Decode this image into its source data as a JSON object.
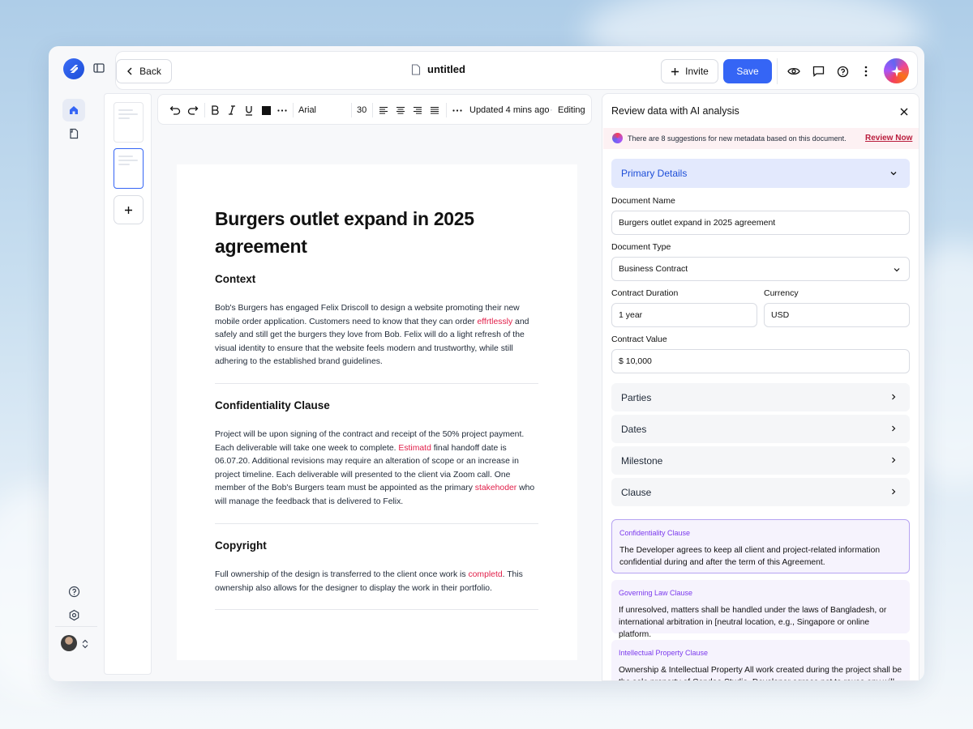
{
  "app": {
    "back_label": "Back",
    "doc_title": "untitled",
    "invite_label": "Invite",
    "save_label": "Save",
    "accent_color": "#3565f5"
  },
  "toolbar": {
    "font_family": "Arial",
    "font_size": "30",
    "updated_text": "Updated 4 mins ago",
    "mode": "Editing"
  },
  "document": {
    "title": "Burgers outlet expand in 2025 agreement",
    "sections": [
      {
        "heading": "Context",
        "parts": [
          "Bob's Burgers has engaged Felix Driscoll to design a website promoting their new mobile order application. Customers need to know that they can order ",
          "effrtlessly",
          " and safely and still get the burgers they love from Bob. Felix will do a light refresh of the visual identity to ensure that the website feels modern and trustworthy, while still adhering to the established brand guidelines."
        ]
      },
      {
        "heading": "Confidentiality Clause",
        "parts": [
          "Project will be upon signing of the contract and receipt of the 50% project payment. Each deliverable will take one week to complete. ",
          "Estimatd",
          " final handoff date is 06.07.20. Additional revisions may require an alteration of scope or an increase in project timeline. Each deliverable will presented to the client via Zoom call. One member of the Bob's Burgers team must be appointed as the primary ",
          "stakehoder",
          " who will manage the feedback that is delivered to Felix."
        ]
      },
      {
        "heading": "Copyright",
        "parts": [
          "Full ownership of the design is transferred to the client once work is ",
          "completd",
          ". This ownership also allows for the designer to display the work in their portfolio."
        ]
      }
    ]
  },
  "panel": {
    "title": "Review data with AI analysis",
    "banner_text": "There are 8 suggestions for new metadata based on this document.",
    "banner_link": "Review Now",
    "section_title": "Primary Details",
    "fields": {
      "document_name": {
        "label": "Document Name",
        "value": "Burgers outlet expand in 2025 agreement"
      },
      "document_type": {
        "label": "Document Type",
        "value": "Business Contract"
      },
      "contract_duration": {
        "label": "Contract Duration",
        "value": "1 year"
      },
      "currency": {
        "label": "Currency",
        "value": "USD"
      },
      "contract_value": {
        "label": "Contract Value",
        "value": "$ 10,000"
      }
    },
    "accordions": [
      "Parties",
      "Dates",
      "Milestone",
      "Clause"
    ],
    "clauses": [
      {
        "title": "Confidentiality Clause",
        "body": "The Developer agrees to keep all client and project-related information confidential during and after the term of this Agreement."
      },
      {
        "title": "Governing Law Clause",
        "body": "If unresolved, matters shall be handled under the laws of Bangladesh, or international arbitration in [neutral location, e.g., Singapore or online platform."
      },
      {
        "title": "Intellectual Property Clause",
        "body": "Ownership & Intellectual Property All work created during the project shall be the sole property of Condoo Studio. Developer agrees not to reuse any will"
      }
    ]
  }
}
